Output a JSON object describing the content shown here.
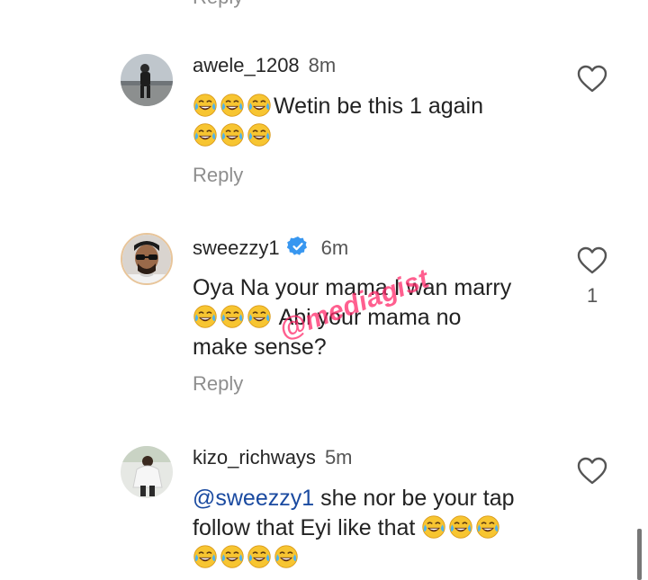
{
  "top": {
    "reply_label": "Reply"
  },
  "comments": [
    {
      "username": "awele_1208",
      "time": "8m",
      "text_line1": "Wetin be this 1 again",
      "reply_label": "Reply",
      "like_count": ""
    },
    {
      "username": "sweezzy1",
      "time": "6m",
      "text_line1": "Oya Na your mama I wan marry",
      "text_line2": " Abi your mama no",
      "text_line3": "make sense?",
      "reply_label": "Reply",
      "like_count": "1"
    },
    {
      "username": "kizo_richways",
      "time": "5m",
      "mention": "@sweezzy1",
      "text_line1": " she nor be your tap",
      "text_line2": "follow that Eyi like that",
      "like_count": ""
    }
  ],
  "watermark": "@mediagist",
  "icons": {
    "emoji": "face-with-tears-of-joy",
    "like": "heart-outline",
    "verified": "verified-badge"
  },
  "colors": {
    "mention": "#1a4aa0",
    "verified": "#3897f0",
    "watermark": "#ff2a6a"
  }
}
